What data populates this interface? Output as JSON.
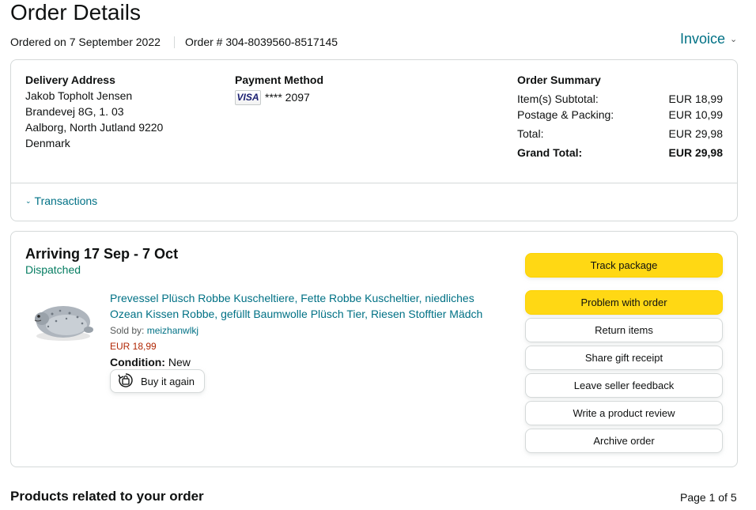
{
  "page": {
    "title": "Order Details",
    "ordered_on": "Ordered on 7 September 2022",
    "order_number": "Order # 304-8039560-8517145",
    "invoice_label": "Invoice"
  },
  "delivery": {
    "heading": "Delivery Address",
    "lines": [
      "Jakob Topholt Jensen",
      "Brandevej 8G, 1. 03",
      "Aalborg, North Jutland 9220",
      "Denmark"
    ]
  },
  "payment": {
    "heading": "Payment Method",
    "card_brand": "VISA",
    "card_number": "**** 2097"
  },
  "summary": {
    "heading": "Order Summary",
    "rows": [
      {
        "label": "Item(s) Subtotal:",
        "value": "EUR 18,99"
      },
      {
        "label": "Postage & Packing:",
        "value": "EUR 10,99"
      },
      {
        "label": "Total:",
        "value": "EUR 29,98"
      },
      {
        "label": "Grand Total:",
        "value": "EUR 29,98"
      }
    ]
  },
  "transactions_label": "Transactions",
  "shipment": {
    "arriving": "Arriving 17 Sep - 7 Oct",
    "status": "Dispatched",
    "product": {
      "title": "Prevessel Plüsch Robbe Kuscheltiere, Fette Robbe Kuscheltier, niedliches Ozean Kissen Robbe, gefüllt Baumwolle Plüsch Tier, Riesen Stofftier Mädch",
      "sold_by_label": "Sold by: ",
      "seller": "meizhanwlkj",
      "price": "EUR 18,99",
      "condition_label": "Condition:",
      "condition_value": "New",
      "buy_again_label": "Buy it again"
    },
    "buttons": {
      "track": "Track package",
      "problem": "Problem with order",
      "return": "Return items",
      "gift": "Share gift receipt",
      "feedback": "Leave seller feedback",
      "review": "Write a product review",
      "archive": "Archive order"
    }
  },
  "related": {
    "heading": "Products related to your order",
    "page_info": "Page 1 of 5"
  },
  "colors": {
    "link": "#007185",
    "dispatched": "#067d62",
    "price": "#b12704",
    "button_yellow": "#ffd814"
  }
}
